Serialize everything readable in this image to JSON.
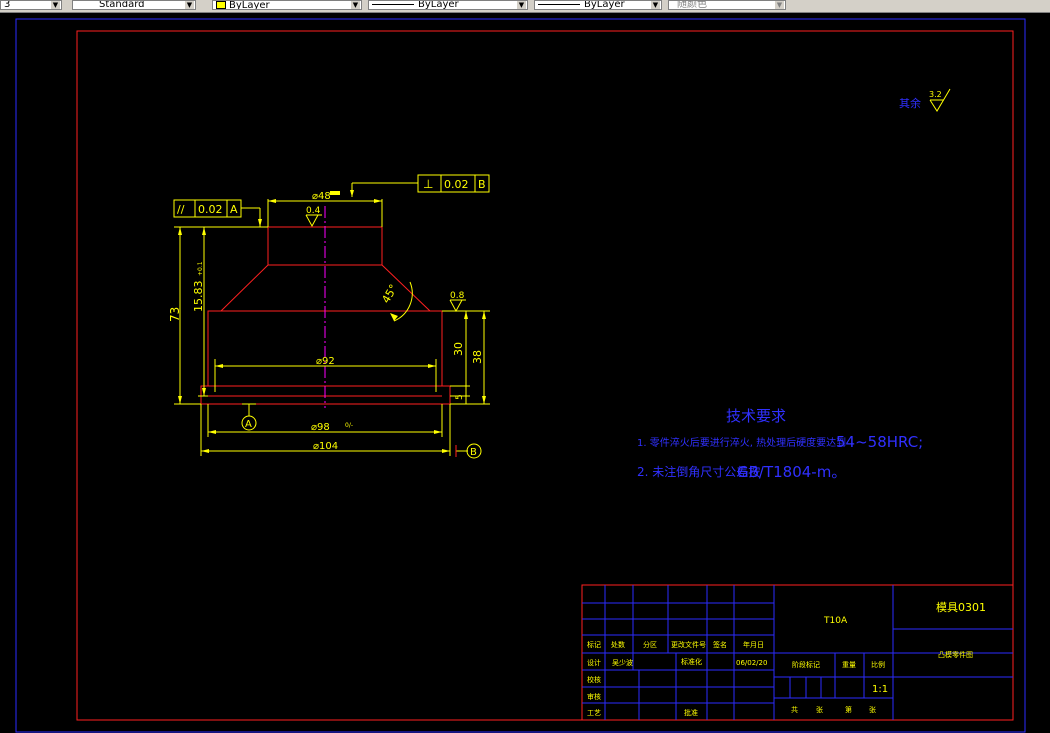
{
  "toolbar": {
    "left_fragment": "3",
    "textstyle": "Standard",
    "layer": "ByLayer",
    "linetype": "ByLayer",
    "lineweight": "ByLayer",
    "plotstyle": "随颜色"
  },
  "roughness": {
    "label": "其余",
    "value": "3.2"
  },
  "part": {
    "gtol_parallel": {
      "symbol": "//",
      "value": "0.02",
      "datum": "A"
    },
    "gtol_perp": {
      "symbol": "⊥",
      "value": "0.02",
      "datum": "B"
    },
    "dim_top_dia": "⌀48",
    "dim_top_dia_tol": "0/-",
    "surface_top": "0.4",
    "dim_height_total": "73",
    "dim_height_mid": "15.83",
    "dim_height_mid_tol": "+0.1",
    "dim_angle": "45°",
    "surface_side": "0.8",
    "dim_30": "30",
    "dim_38": "38",
    "dim_5": "5",
    "dim_92": "⌀92",
    "dim_98": "⌀98",
    "dim_98_tol": "0/-",
    "dim_104": "⌀104",
    "datum_a": "A",
    "datum_b": "B"
  },
  "requirements": {
    "title": "技术要求",
    "item1_prefix": "1.  零件淬火后要进行淬火, 热处理后硬度要达到",
    "item1_suffix": "54~58HRC;",
    "item2_prefix": "2. 未注倒角尺寸公差按",
    "item2_suffix": "GB/T1804-m。"
  },
  "titleblock": {
    "material": "T10A",
    "drawing_no": "模具0301",
    "part_name": "凸模零件图",
    "headers": [
      "标记",
      "处数",
      "分区",
      "更改文件号",
      "签名",
      "年月日"
    ],
    "row_design": [
      "设计",
      "吴少波",
      "",
      "标准化",
      "",
      "06/02/20"
    ],
    "label_check": "校核",
    "label_review": "审核",
    "label_process": "工艺",
    "label_approve": "批准",
    "stage_mark": "阶段标记",
    "weight": "重量",
    "scale_label": "比例",
    "scale_value": "1:1",
    "sheets": [
      "共",
      "张",
      "第",
      "张"
    ]
  }
}
